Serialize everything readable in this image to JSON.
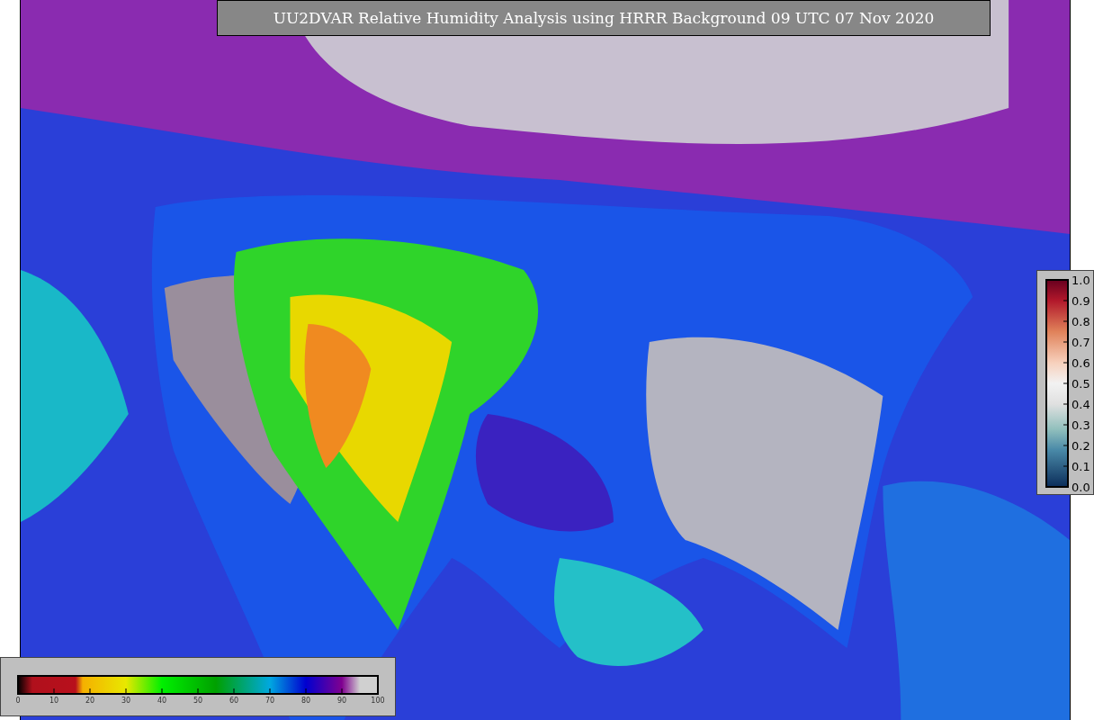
{
  "title": "UU2DVAR Relative Humidity Analysis using HRRR Background 09 UTC 07 Nov 2020",
  "side_colorbar": {
    "labels": [
      "1.0",
      "0.9",
      "0.8",
      "0.7",
      "0.6",
      "0.5",
      "0.4",
      "0.3",
      "0.2",
      "0.1",
      "0.0"
    ]
  },
  "bottom_colorbar": {
    "labels": [
      "0",
      "10",
      "20",
      "30",
      "40",
      "50",
      "60",
      "70",
      "80",
      "90",
      "100"
    ]
  }
}
